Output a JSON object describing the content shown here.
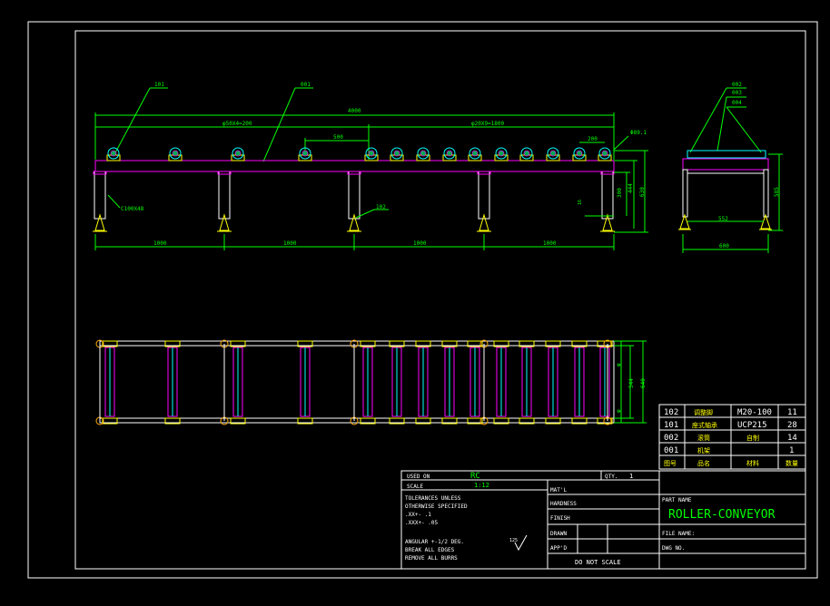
{
  "colors": {
    "background": "#000000",
    "frame": "#ffffff",
    "dimension": "#00ff00",
    "body": "#ff00ff",
    "roller": "#00ffff",
    "support": "#ffff00"
  },
  "front_view": {
    "balloons": [
      "101",
      "001",
      "102"
    ],
    "dims": {
      "overall": "4000",
      "left_pitch": "φ50X4=200",
      "right_pitch": "φ20X9=1800",
      "mid_pitch": "500",
      "end_pitch": "200",
      "roller_dia": "Φ89.1",
      "height_1": "300",
      "height_2": "444",
      "height_3": "630",
      "leg_note": "C100X48",
      "foot": "16",
      "span_1": "1000",
      "span_2": "1000",
      "span_3": "1000",
      "span_4": "1000"
    }
  },
  "side_view": {
    "balloons": [
      "002",
      "003",
      "004"
    ],
    "dims": {
      "height": "585",
      "inner": "552",
      "overall": "600"
    }
  },
  "top_view": {
    "dims": {
      "d1": "φ",
      "d2": "φ",
      "width_1": "544",
      "width_2": "640"
    }
  },
  "bom": {
    "rows": [
      {
        "no": "102",
        "name": "调整脚",
        "spec": "M20-100",
        "qty": "11"
      },
      {
        "no": "101",
        "name": "座式轴承",
        "spec": "UCP215",
        "qty": "28"
      },
      {
        "no": "002",
        "name": "滚筒",
        "spec": "自制",
        "qty": "14"
      },
      {
        "no": "001",
        "name": "机架",
        "spec": "",
        "qty": "1"
      }
    ],
    "header": {
      "no": "图号",
      "name": "品名",
      "spec": "材料",
      "qty": "数量"
    }
  },
  "title_block": {
    "used_on_label": "USED ON",
    "used_on_value": "RC",
    "qty_label": "QTY.",
    "qty_value": "1",
    "scale_label": "SCALE",
    "scale_value": "1:12",
    "tolerance_lines": [
      "TOLERANCES UNLESS",
      "OTHERWISE SPECIFIED",
      ".XX+-        .1",
      ".XXX+-       .05"
    ],
    "general_lines": [
      "ANGULAR +-1/2 DEG.",
      "BREAK ALL EDGES",
      "REMOVE ALL BURRS"
    ],
    "surface_mark": "125",
    "matl": "MAT'L",
    "hardness": "HARDNESS",
    "finish": "FINISH",
    "drawn": "DRAWN",
    "appd": "APP'D",
    "do_not_scale": "DO NOT SCALE",
    "part_name_label": "PART NAME",
    "part_name": "ROLLER-CONVEYOR",
    "file_name_label": "FILE NAME:",
    "dwg_no_label": "DWG NO."
  }
}
